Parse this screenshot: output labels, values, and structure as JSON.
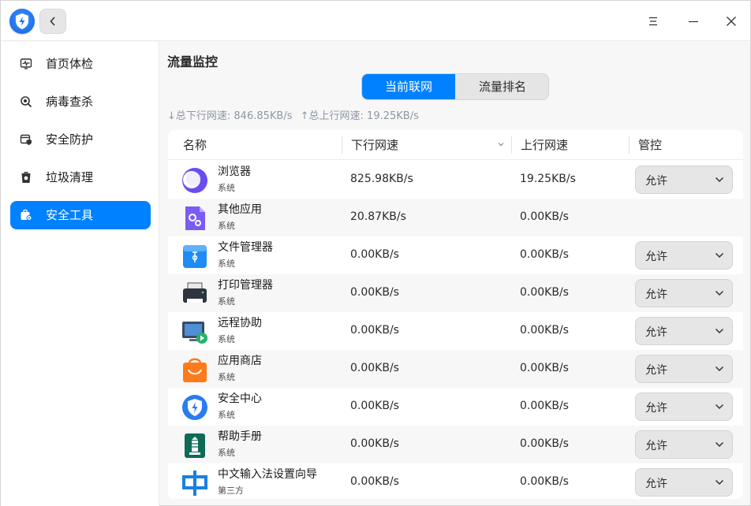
{
  "titlebar": {
    "back_icon": "chevron-left-icon",
    "menu_icon": "menu-icon",
    "minimize_icon": "minimize-icon",
    "close_icon": "close-icon"
  },
  "sidebar": {
    "items": [
      {
        "label": "首页体检",
        "icon": "checkup-icon",
        "active": false
      },
      {
        "label": "病毒查杀",
        "icon": "virus-scan-icon",
        "active": false
      },
      {
        "label": "安全防护",
        "icon": "protection-icon",
        "active": false
      },
      {
        "label": "垃圾清理",
        "icon": "trash-icon",
        "active": false
      },
      {
        "label": "安全工具",
        "icon": "toolbox-icon",
        "active": true
      }
    ]
  },
  "main": {
    "title": "流量监控",
    "tabs": [
      {
        "label": "当前联网",
        "active": true
      },
      {
        "label": "流量排名",
        "active": false
      }
    ],
    "summary": {
      "down": "↓总下行网速: 846.85KB/s",
      "up": "↑总上行网速: 19.25KB/s"
    },
    "table": {
      "headers": {
        "name": "名称",
        "down": "下行网速",
        "up": "上行网速",
        "control": "管控"
      },
      "rows": [
        {
          "name": "浏览器",
          "type": "系统",
          "down": "825.98KB/s",
          "up": "19.25KB/s",
          "control": "允许",
          "icon": "browser-icon"
        },
        {
          "name": "其他应用",
          "type": "系统",
          "down": "20.87KB/s",
          "up": "0.00KB/s",
          "control": "",
          "icon": "other-apps-icon"
        },
        {
          "name": "文件管理器",
          "type": "系统",
          "down": "0.00KB/s",
          "up": "0.00KB/s",
          "control": "允许",
          "icon": "file-manager-icon"
        },
        {
          "name": "打印管理器",
          "type": "系统",
          "down": "0.00KB/s",
          "up": "0.00KB/s",
          "control": "允许",
          "icon": "printer-icon"
        },
        {
          "name": "远程协助",
          "type": "系统",
          "down": "0.00KB/s",
          "up": "0.00KB/s",
          "control": "允许",
          "icon": "remote-assist-icon"
        },
        {
          "name": "应用商店",
          "type": "系统",
          "down": "0.00KB/s",
          "up": "0.00KB/s",
          "control": "允许",
          "icon": "app-store-icon"
        },
        {
          "name": "安全中心",
          "type": "系统",
          "down": "0.00KB/s",
          "up": "0.00KB/s",
          "control": "允许",
          "icon": "security-center-icon"
        },
        {
          "name": "帮助手册",
          "type": "系统",
          "down": "0.00KB/s",
          "up": "0.00KB/s",
          "control": "允许",
          "icon": "help-manual-icon"
        },
        {
          "name": "中文输入法设置向导",
          "type": "第三方",
          "down": "0.00KB/s",
          "up": "0.00KB/s",
          "control": "允许",
          "icon": "input-method-icon"
        }
      ]
    }
  },
  "colors": {
    "accent": "#0081ff",
    "sidebar_bg": "#ffffff",
    "page_bg": "#f7f7f7"
  }
}
